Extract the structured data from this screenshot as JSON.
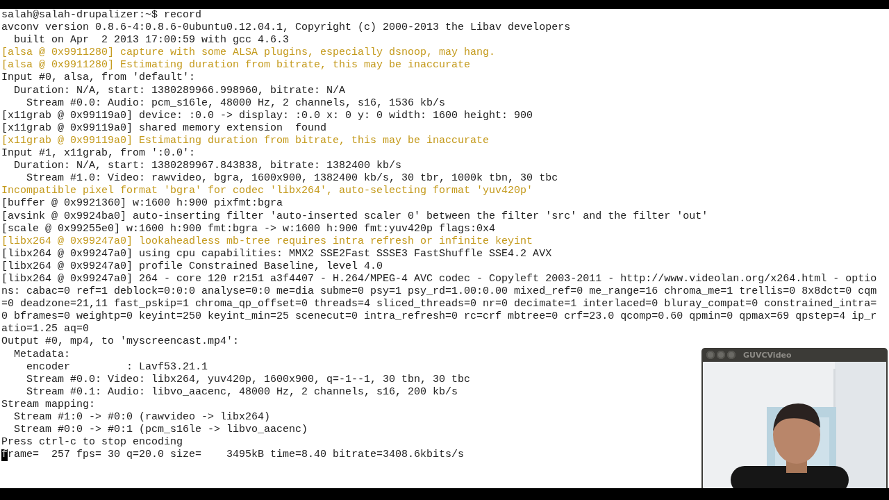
{
  "terminal": {
    "lines": [
      {
        "text": "salah@salah-drupalizer:~$ record",
        "kind": "normal"
      },
      {
        "text": "avconv version 0.8.6-4:0.8.6-0ubuntu0.12.04.1, Copyright (c) 2000-2013 the Libav developers",
        "kind": "normal"
      },
      {
        "text": "  built on Apr  2 2013 17:00:59 with gcc 4.6.3",
        "kind": "normal"
      },
      {
        "text": "[alsa @ 0x9911280] capture with some ALSA plugins, especially dsnoop, may hang.",
        "kind": "warning"
      },
      {
        "text": "[alsa @ 0x9911280] Estimating duration from bitrate, this may be inaccurate",
        "kind": "warning"
      },
      {
        "text": "Input #0, alsa, from 'default':",
        "kind": "normal"
      },
      {
        "text": "  Duration: N/A, start: 1380289966.998960, bitrate: N/A",
        "kind": "normal"
      },
      {
        "text": "    Stream #0.0: Audio: pcm_s16le, 48000 Hz, 2 channels, s16, 1536 kb/s",
        "kind": "normal"
      },
      {
        "text": "[x11grab @ 0x99119a0] device: :0.0 -> display: :0.0 x: 0 y: 0 width: 1600 height: 900",
        "kind": "normal"
      },
      {
        "text": "[x11grab @ 0x99119a0] shared memory extension  found",
        "kind": "normal"
      },
      {
        "text": "[x11grab @ 0x99119a0] Estimating duration from bitrate, this may be inaccurate",
        "kind": "warning"
      },
      {
        "text": "Input #1, x11grab, from ':0.0':",
        "kind": "normal"
      },
      {
        "text": "  Duration: N/A, start: 1380289967.843838, bitrate: 1382400 kb/s",
        "kind": "normal"
      },
      {
        "text": "    Stream #1.0: Video: rawvideo, bgra, 1600x900, 1382400 kb/s, 30 tbr, 1000k tbn, 30 tbc",
        "kind": "normal"
      },
      {
        "text": "Incompatible pixel format 'bgra' for codec 'libx264', auto-selecting format 'yuv420p'",
        "kind": "warning"
      },
      {
        "text": "[buffer @ 0x9921360] w:1600 h:900 pixfmt:bgra",
        "kind": "normal"
      },
      {
        "text": "[avsink @ 0x9924ba0] auto-inserting filter 'auto-inserted scaler 0' between the filter 'src' and the filter 'out'",
        "kind": "normal"
      },
      {
        "text": "[scale @ 0x99255e0] w:1600 h:900 fmt:bgra -> w:1600 h:900 fmt:yuv420p flags:0x4",
        "kind": "normal"
      },
      {
        "text": "[libx264 @ 0x99247a0] lookaheadless mb-tree requires intra refresh or infinite keyint",
        "kind": "warning"
      },
      {
        "text": "[libx264 @ 0x99247a0] using cpu capabilities: MMX2 SSE2Fast SSSE3 FastShuffle SSE4.2 AVX",
        "kind": "normal"
      },
      {
        "text": "[libx264 @ 0x99247a0] profile Constrained Baseline, level 4.0",
        "kind": "normal"
      },
      {
        "text": "[libx264 @ 0x99247a0] 264 - core 120 r2151 a3f4407 - H.264/MPEG-4 AVC codec - Copyleft 2003-2011 - http://www.videolan.org/x264.html - optio",
        "kind": "normal"
      },
      {
        "text": "ns: cabac=0 ref=1 deblock=0:0:0 analyse=0:0 me=dia subme=0 psy=1 psy_rd=1.00:0.00 mixed_ref=0 me_range=16 chroma_me=1 trellis=0 8x8dct=0 cqm",
        "kind": "normal"
      },
      {
        "text": "=0 deadzone=21,11 fast_pskip=1 chroma_qp_offset=0 threads=4 sliced_threads=0 nr=0 decimate=1 interlaced=0 bluray_compat=0 constrained_intra=",
        "kind": "normal"
      },
      {
        "text": "0 bframes=0 weightp=0 keyint=250 keyint_min=25 scenecut=0 intra_refresh=0 rc=crf mbtree=0 crf=23.0 qcomp=0.60 qpmin=0 qpmax=69 qpstep=4 ip_r",
        "kind": "normal"
      },
      {
        "text": "atio=1.25 aq=0",
        "kind": "normal"
      },
      {
        "text": "Output #0, mp4, to 'myscreencast.mp4':",
        "kind": "normal"
      },
      {
        "text": "  Metadata:",
        "kind": "normal"
      },
      {
        "text": "    encoder         : Lavf53.21.1",
        "kind": "normal"
      },
      {
        "text": "    Stream #0.0: Video: libx264, yuv420p, 1600x900, q=-1--1, 30 tbn, 30 tbc",
        "kind": "normal"
      },
      {
        "text": "    Stream #0.1: Audio: libvo_aacenc, 48000 Hz, 2 channels, s16, 200 kb/s",
        "kind": "normal"
      },
      {
        "text": "Stream mapping:",
        "kind": "normal"
      },
      {
        "text": "  Stream #1:0 -> #0:0 (rawvideo -> libx264)",
        "kind": "normal"
      },
      {
        "text": "  Stream #0:0 -> #0:1 (pcm_s16le -> libvo_aacenc)",
        "kind": "normal"
      },
      {
        "text": "Press ctrl-c to stop encoding",
        "kind": "normal"
      },
      {
        "text": "frame=  257 fps= 30 q=20.0 size=    3495kB time=8.40 bitrate=3408.6kbits/s",
        "kind": "normal",
        "cursor": true
      }
    ]
  },
  "webcam_window": {
    "title": "GUVCVideo",
    "kind": "picture"
  }
}
